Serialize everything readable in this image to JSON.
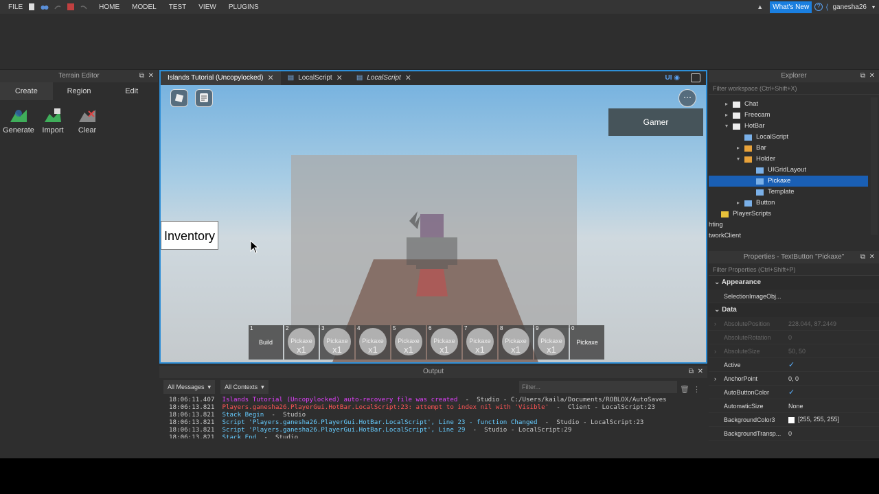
{
  "menu": {
    "file": "FILE",
    "tabs": [
      "HOME",
      "MODEL",
      "TEST",
      "VIEW",
      "PLUGINS"
    ],
    "whats_new": "What's New",
    "user": "ganesha26"
  },
  "terrain": {
    "title": "Terrain Editor",
    "tabs": [
      "Create",
      "Region",
      "Edit"
    ],
    "tools": [
      "Generate",
      "Import",
      "Clear"
    ]
  },
  "viewport": {
    "tabs": [
      "Islands Tutorial (Uncopylocked)",
      "LocalScript",
      "LocalScript"
    ],
    "ui_toggle": "UI",
    "gamer_label": "Gamer",
    "inventory_label": "Inventory",
    "hotbar": [
      {
        "num": "1",
        "label": "Build",
        "circle": false,
        "count": ""
      },
      {
        "num": "2",
        "label": "Pickaxe",
        "circle": true,
        "count": "x1"
      },
      {
        "num": "3",
        "label": "Pickaxe",
        "circle": true,
        "count": "x1"
      },
      {
        "num": "4",
        "label": "Pickaxe",
        "circle": true,
        "count": "x1"
      },
      {
        "num": "5",
        "label": "Pickaxe",
        "circle": true,
        "count": "x1"
      },
      {
        "num": "6",
        "label": "Pickaxe",
        "circle": true,
        "count": "x1"
      },
      {
        "num": "7",
        "label": "Pickaxe",
        "circle": true,
        "count": "x1"
      },
      {
        "num": "8",
        "label": "Pickaxe",
        "circle": true,
        "count": "x1"
      },
      {
        "num": "9",
        "label": "Pickaxe",
        "circle": true,
        "count": "x1"
      },
      {
        "num": "0",
        "label": "Pickaxe",
        "circle": false,
        "count": ""
      }
    ]
  },
  "output": {
    "title": "Output",
    "filter_messages": "All Messages",
    "filter_contexts": "All Contexts",
    "filter_placeholder": "Filter...",
    "logs": [
      {
        "time": "18:06:11.407",
        "text": "Islands Tutorial (Uncopylocked) auto-recovery file was created",
        "suffix": "  -  Studio - C:/Users/kaila/Documents/ROBLOX/AutoSaves",
        "color": "pink"
      },
      {
        "time": "18:06:13.821",
        "text": "Players.ganesha26.PlayerGui.HotBar.LocalScript:23: attempt to index nil with 'Visible'",
        "suffix": "  -  Client - LocalScript:23",
        "color": "red"
      },
      {
        "time": "18:06:13.821",
        "text": "Stack Begin",
        "suffix": "  -  Studio",
        "color": "cyan"
      },
      {
        "time": "18:06:13.821",
        "text": "Script 'Players.ganesha26.PlayerGui.HotBar.LocalScript', Line 23 - function Changed",
        "suffix": "  -  Studio - LocalScript:23",
        "color": "cyan"
      },
      {
        "time": "18:06:13.821",
        "text": "Script 'Players.ganesha26.PlayerGui.HotBar.LocalScript', Line 29",
        "suffix": "  -  Studio - LocalScript:29",
        "color": "cyan"
      },
      {
        "time": "18:06:13.821",
        "text": "Stack End",
        "suffix": "  -  Studio",
        "color": "cyan"
      }
    ]
  },
  "explorer": {
    "title": "Explorer",
    "filter_placeholder": "Filter workspace (Ctrl+Shift+X)",
    "items": [
      {
        "label": "Chat",
        "depth": 1,
        "arrow": "▸",
        "icon": "folder-white",
        "selected": false
      },
      {
        "label": "Freecam",
        "depth": 1,
        "arrow": "▸",
        "icon": "folder-white",
        "selected": false
      },
      {
        "label": "HotBar",
        "depth": 1,
        "arrow": "▾",
        "icon": "folder-white",
        "selected": false
      },
      {
        "label": "LocalScript",
        "depth": 2,
        "arrow": "",
        "icon": "script",
        "selected": false
      },
      {
        "label": "Bar",
        "depth": 2,
        "arrow": "▸",
        "icon": "frame",
        "selected": false
      },
      {
        "label": "Holder",
        "depth": 2,
        "arrow": "▾",
        "icon": "frame",
        "selected": false
      },
      {
        "label": "UIGridLayout",
        "depth": 3,
        "arrow": "",
        "icon": "layout",
        "selected": false
      },
      {
        "label": "Pickaxe",
        "depth": 3,
        "arrow": "",
        "icon": "button",
        "selected": true
      },
      {
        "label": "Template",
        "depth": 3,
        "arrow": "",
        "icon": "button",
        "selected": false
      },
      {
        "label": "Button",
        "depth": 2,
        "arrow": "▸",
        "icon": "button",
        "selected": false
      },
      {
        "label": "PlayerScripts",
        "depth": 0,
        "arrow": "",
        "icon": "folder",
        "selected": false
      },
      {
        "label": "hting",
        "depth": -1,
        "arrow": "",
        "icon": "",
        "selected": false
      },
      {
        "label": "tworkClient",
        "depth": -1,
        "arrow": "",
        "icon": "",
        "selected": false
      }
    ]
  },
  "properties": {
    "title": "Properties - TextButton \"Pickaxe\"",
    "filter_placeholder": "Filter Properties (Ctrl+Shift+P)",
    "sections": [
      {
        "name": "Appearance",
        "rows": [
          {
            "name": "SelectionImageObj...",
            "value": "",
            "disabled": false,
            "arrow": false,
            "check": false,
            "swatch": false
          }
        ]
      },
      {
        "name": "Data",
        "rows": [
          {
            "name": "AbsolutePosition",
            "value": "228.044, 87.2449",
            "disabled": true,
            "arrow": true,
            "check": false,
            "swatch": false
          },
          {
            "name": "AbsoluteRotation",
            "value": "0",
            "disabled": true,
            "arrow": false,
            "check": false,
            "swatch": false
          },
          {
            "name": "AbsoluteSize",
            "value": "50, 50",
            "disabled": true,
            "arrow": true,
            "check": false,
            "swatch": false
          },
          {
            "name": "Active",
            "value": "✓",
            "disabled": false,
            "arrow": false,
            "check": true,
            "swatch": false
          },
          {
            "name": "AnchorPoint",
            "value": "0, 0",
            "disabled": false,
            "arrow": true,
            "check": false,
            "swatch": false
          },
          {
            "name": "AutoButtonColor",
            "value": "✓",
            "disabled": false,
            "arrow": false,
            "check": true,
            "swatch": false
          },
          {
            "name": "AutomaticSize",
            "value": "None",
            "disabled": false,
            "arrow": false,
            "check": false,
            "swatch": false
          },
          {
            "name": "BackgroundColor3",
            "value": "[255, 255, 255]",
            "disabled": false,
            "arrow": false,
            "check": false,
            "swatch": true
          },
          {
            "name": "BackgroundTransp...",
            "value": "0",
            "disabled": false,
            "arrow": false,
            "check": false,
            "swatch": false
          }
        ]
      }
    ]
  },
  "colors": {
    "accent": "#1a7fe0",
    "selection": "#1a5fb4",
    "viewport_border": "#2e8fd8"
  }
}
